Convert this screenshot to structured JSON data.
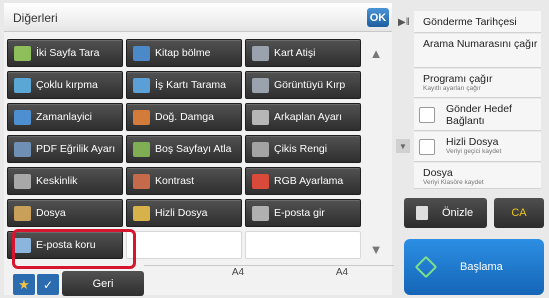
{
  "header": {
    "title": "Diğerleri",
    "ok_label": "OK"
  },
  "functions": [
    {
      "label": "İki Sayfa Tara",
      "icon": "two-page-scan-icon",
      "color": "#8fbf5a"
    },
    {
      "label": "Kitap bölme",
      "icon": "book-divide-icon",
      "color": "#4b89c9"
    },
    {
      "label": "Kart Atişi",
      "icon": "card-shot-icon",
      "color": "#9aa3ad"
    },
    {
      "label": "Çoklu kırpma",
      "icon": "multi-crop-icon",
      "color": "#5aa7d6"
    },
    {
      "label": "İş Kartı Tarama",
      "icon": "business-card-scan-icon",
      "color": "#5a9fd6"
    },
    {
      "label": "Görüntüyü Kırp",
      "icon": "image-crop-icon",
      "color": "#9aa3ad"
    },
    {
      "label": "Zamanlayici",
      "icon": "timer-icon",
      "color": "#4d8fd0"
    },
    {
      "label": "Doğ. Damga",
      "icon": "verification-stamp-icon",
      "color": "#d27b3b"
    },
    {
      "label": "Arkaplan Ayarı",
      "icon": "background-adjust-icon",
      "color": "#b6b6b6"
    },
    {
      "label": "PDF Eğrilik Ayarı",
      "icon": "pdf-skew-adjust-icon",
      "color": "#6f8fb4"
    },
    {
      "label": "Boş Sayfayı Atla",
      "icon": "skip-blank-page-icon",
      "color": "#7fae54"
    },
    {
      "label": "Çikis Rengi",
      "icon": "output-color-icon",
      "color": "#a3a3a3"
    },
    {
      "label": "Keskinlik",
      "icon": "sharpness-icon",
      "color": "#a8a8a8"
    },
    {
      "label": "Kontrast",
      "icon": "contrast-icon",
      "color": "#c56b4b"
    },
    {
      "label": "RGB Ayarlama",
      "icon": "rgb-adjust-icon",
      "color": "#d94a3b"
    },
    {
      "label": "Dosya",
      "icon": "file-icon",
      "color": "#c9a05a"
    },
    {
      "label": "Hizli Dosya",
      "icon": "quick-file-icon",
      "color": "#d7b14a"
    },
    {
      "label": "E-posta gir",
      "icon": "email-enter-icon",
      "color": "#b0b0b0"
    },
    {
      "label": "E-posta koru",
      "icon": "email-protect-icon",
      "color": "#8cb5de"
    },
    {
      "label": "",
      "icon": "",
      "color": ""
    },
    {
      "label": "",
      "icon": "",
      "color": ""
    }
  ],
  "paper_sizes": [
    "A4",
    "A4"
  ],
  "bottom": {
    "back_label": "Geri"
  },
  "right_panel": {
    "items": [
      {
        "title": "Gönderme Tarihçesi",
        "subtitle": ""
      },
      {
        "title": "Arama Numarasını çağır",
        "subtitle": ""
      },
      {
        "title": "Programı çağır",
        "subtitle": "Kayıtlı ayarları çağır"
      },
      {
        "title": "Gönder Hedef Bağlantı",
        "subtitle": ""
      },
      {
        "title": "Hizli Dosya",
        "subtitle": "Veriyi geçici kaydet"
      },
      {
        "title": "Dosya",
        "subtitle": "Veriyi Klasöre kaydet"
      }
    ],
    "preview_label": "Önizle",
    "ca_label": "CA",
    "start_label": "Başlama"
  }
}
